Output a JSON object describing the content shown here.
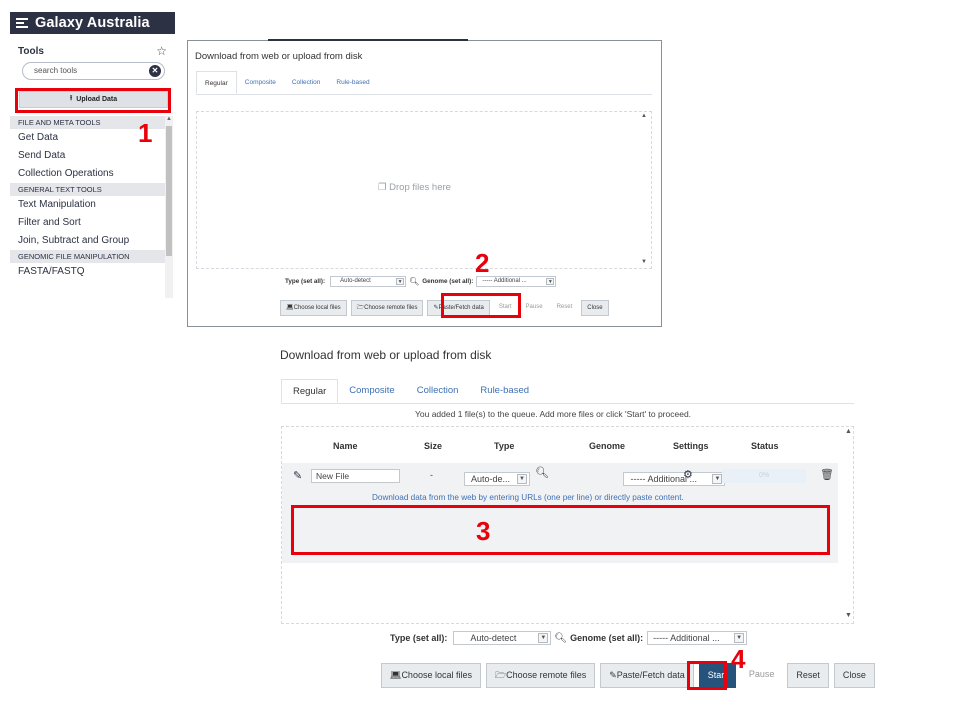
{
  "sidebar": {
    "brand": "Galaxy Australia",
    "tools_title": "Tools",
    "search_placeholder": "search tools",
    "upload_label": "Upload Data",
    "items": [
      {
        "type": "section",
        "label": "FILE AND META TOOLS"
      },
      {
        "type": "tool",
        "label": "Get Data"
      },
      {
        "type": "tool",
        "label": "Send Data"
      },
      {
        "type": "tool",
        "label": "Collection Operations"
      },
      {
        "type": "section",
        "label": "GENERAL TEXT TOOLS"
      },
      {
        "type": "tool",
        "label": "Text Manipulation"
      },
      {
        "type": "tool",
        "label": "Filter and Sort"
      },
      {
        "type": "tool",
        "label": "Join, Subtract and Group"
      },
      {
        "type": "section",
        "label": "GENOMIC FILE MANIPULATION"
      },
      {
        "type": "tool",
        "label": "FASTA/FASTQ"
      }
    ]
  },
  "dialog1": {
    "title": "Download from web or upload from disk",
    "tabs": [
      "Regular",
      "Composite",
      "Collection",
      "Rule-based"
    ],
    "drop_text": "Drop files here",
    "type_label": "Type (set all):",
    "type_value": "Auto-detect",
    "genome_label": "Genome (set all):",
    "genome_value": "----- Additional ...",
    "buttons": {
      "choose_local": "Choose local files",
      "choose_remote": "Choose remote files",
      "paste_fetch": "Paste/Fetch data",
      "start": "Start",
      "pause": "Pause",
      "reset": "Reset",
      "close": "Close"
    }
  },
  "dialog2": {
    "title": "Download from web or upload from disk",
    "tabs": [
      "Regular",
      "Composite",
      "Collection",
      "Rule-based"
    ],
    "queue_message": "You added 1 file(s) to the queue. Add more files or click 'Start' to proceed.",
    "columns": [
      "Name",
      "Size",
      "Type",
      "Genome",
      "Settings",
      "Status"
    ],
    "file_row": {
      "name": "New File",
      "size": "-",
      "type": "Auto-de...",
      "genome": "----- Additional ...",
      "status": "0%"
    },
    "url_hint": "Download data from the web by entering URLs (one per line) or directly paste content.",
    "type_label": "Type (set all):",
    "type_value": "Auto-detect",
    "genome_label": "Genome (set all):",
    "genome_value": "----- Additional ...",
    "buttons": {
      "choose_local": "Choose local files",
      "choose_remote": "Choose remote files",
      "paste_fetch": "Paste/Fetch data",
      "start": "Start",
      "pause": "Pause",
      "reset": "Reset",
      "close": "Close"
    }
  },
  "callouts": [
    "1",
    "2",
    "3",
    "4"
  ],
  "colors": {
    "masthead": "#2c3143",
    "highlight": "#e8000b",
    "primary_button": "#25537b",
    "link": "#3f70b4"
  }
}
